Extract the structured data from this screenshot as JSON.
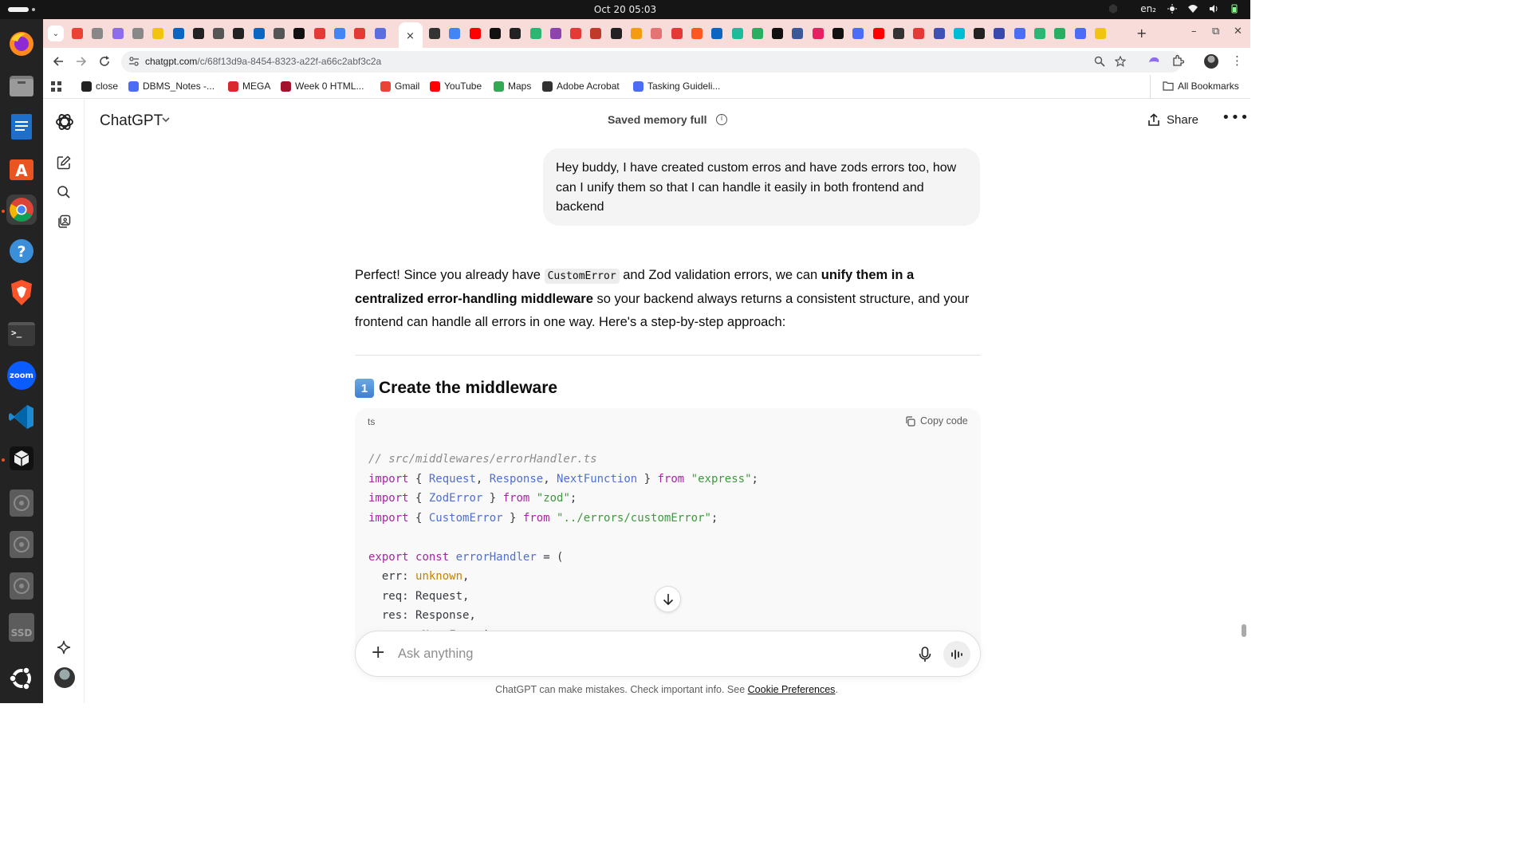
{
  "os": {
    "clock": "Oct 20  05:03",
    "locale": "en₂",
    "tray_icons": [
      "brightness-icon",
      "wifi-icon",
      "volume-icon",
      "battery-icon"
    ]
  },
  "dock": {
    "apps": [
      "firefox-icon",
      "files-icon",
      "writer-icon",
      "app-center-icon",
      "chrome-icon",
      "help-icon",
      "brave-icon",
      "terminal-icon",
      "zoom-icon",
      "vscode-icon",
      "cube-app-icon",
      "disk-icon",
      "disk-icon",
      "disk-icon",
      "ssd-icon",
      "ubuntu-logo-icon"
    ],
    "zoom_label": "zoom",
    "ssd_label": "SSD",
    "terminal_label": ">_"
  },
  "browser": {
    "url_host": "chatgpt.com",
    "url_path": "/c/68f13d9a-8454-8323-a22f-a66c2abf3c2a",
    "new_tab": "+",
    "tab_close": "×",
    "window_controls": {
      "minimize": "–",
      "restore": "⧉",
      "close": "✕"
    }
  },
  "bookmarks": {
    "items": [
      {
        "label": "close",
        "color": "#222222"
      },
      {
        "label": "DBMS_Notes -...",
        "color": "#4a6cf7"
      },
      {
        "label": "MEGA",
        "color": "#d9272e"
      },
      {
        "label": "Week 0 HTML...",
        "color": "#a3122a"
      },
      {
        "label": "Gmail",
        "color": "#ea4335"
      },
      {
        "label": "YouTube",
        "color": "#ff0000"
      },
      {
        "label": "Maps",
        "color": "#34a853"
      },
      {
        "label": "Adobe Acrobat",
        "color": "#333333"
      },
      {
        "label": "Tasking Guideli...",
        "color": "#4a6cf7"
      }
    ],
    "all_bookmarks": "All Bookmarks"
  },
  "header": {
    "model": "ChatGPT",
    "memory_status": "Saved memory full",
    "share_label": "Share"
  },
  "conversation": {
    "user_message": "Hey buddy, I have created custom erros and have zods errors too, how can I unify them so that I can handle it easily in both frontend and backend",
    "answer": {
      "p1": "Perfect! Since you already have ",
      "code1": "CustomError",
      "p2": " and Zod validation errors, we can ",
      "bold1": "unify them in a centralized error-handling middleware",
      "p3": " so your backend always returns a consistent structure, and your frontend can handle all errors in one way. Here's a step-by-step approach:"
    },
    "section": {
      "number": "1",
      "title": "Create the middleware"
    },
    "code_block": {
      "language": "ts",
      "copy_label": "Copy code"
    }
  },
  "composer": {
    "placeholder": "Ask anything"
  },
  "footer": {
    "note": "ChatGPT can make mistakes. Check important info. See ",
    "link": "Cookie Preferences",
    "tail": "."
  },
  "colors": {
    "tabstrip": "#f8dcd9",
    "code_keyword": "#a626a4",
    "code_type": "#4f6fd1",
    "code_string": "#3c9a3c"
  }
}
